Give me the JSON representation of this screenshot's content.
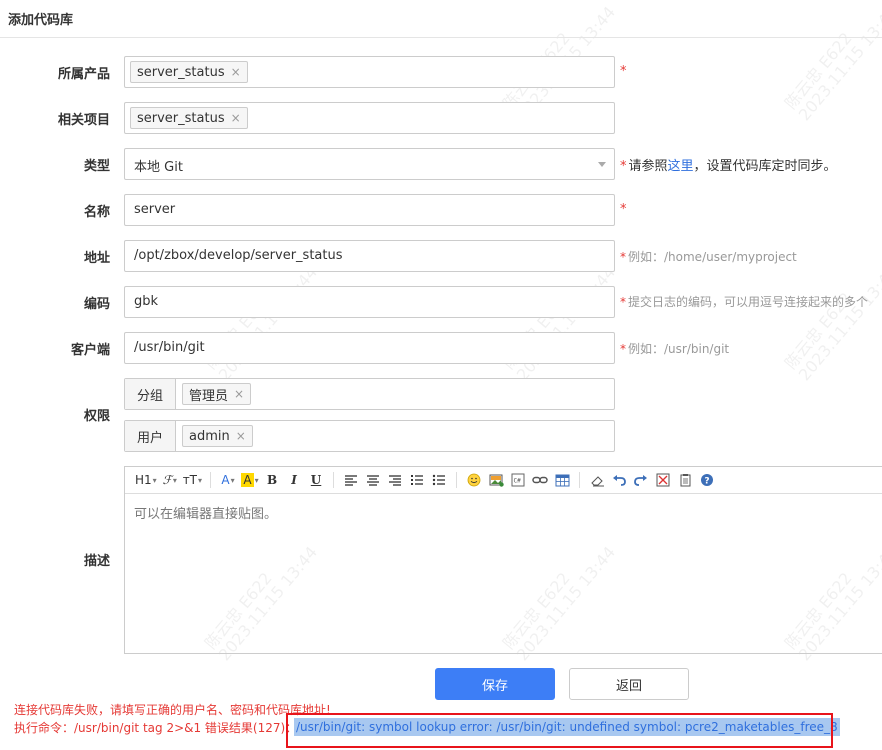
{
  "page": {
    "title": "添加代码库"
  },
  "form": {
    "product": {
      "label": "所属产品",
      "chip": "server_status",
      "required": "*"
    },
    "project": {
      "label": "相关项目",
      "chip": "server_status"
    },
    "type": {
      "label": "类型",
      "value": "本地 Git",
      "hint_star": "*",
      "hint_before": "请参照",
      "hint_link": "这里",
      "hint_after": "，设置代码库定时同步。"
    },
    "name": {
      "label": "名称",
      "value": "server",
      "required": "*"
    },
    "address": {
      "label": "地址",
      "value": "/opt/zbox/develop/server_status",
      "hint_star": "*",
      "hint": "例如：/home/user/myproject"
    },
    "encoding": {
      "label": "编码",
      "value": "gbk",
      "hint_star": "*",
      "hint": "提交日志的编码，可以用逗号连接起来的多个"
    },
    "client": {
      "label": "客户端",
      "value": "/usr/bin/git",
      "hint_star": "*",
      "hint": "例如：/usr/bin/git"
    },
    "permission": {
      "label": "权限",
      "group": {
        "addon": "分组",
        "chip": "管理员"
      },
      "user": {
        "addon": "用户",
        "chip": "admin"
      }
    },
    "description": {
      "label": "描述",
      "placeholder": "可以在编辑器直接贴图。"
    }
  },
  "toolbar": {
    "heading": "H1",
    "font": "𝓕",
    "font_size": "тT",
    "font_color": "A",
    "highlight": "A",
    "bold": "B",
    "italic": "I",
    "underline": "U"
  },
  "buttons": {
    "save": "保存",
    "back": "返回"
  },
  "error": {
    "line1": "连接代码库失败，请填写正确的用户名、密码和代码库地址!",
    "line2_prefix": "执行命令：/usr/bin/git tag 2>&1 错误结果(127)：",
    "line2_detail": "/usr/bin/git: symbol lookup error: /usr/bin/git: undefined symbol: pcre2_maketables_free_8"
  },
  "watermark": {
    "name": "陈云忠 E622",
    "time": "2023.11.15 13:44"
  }
}
